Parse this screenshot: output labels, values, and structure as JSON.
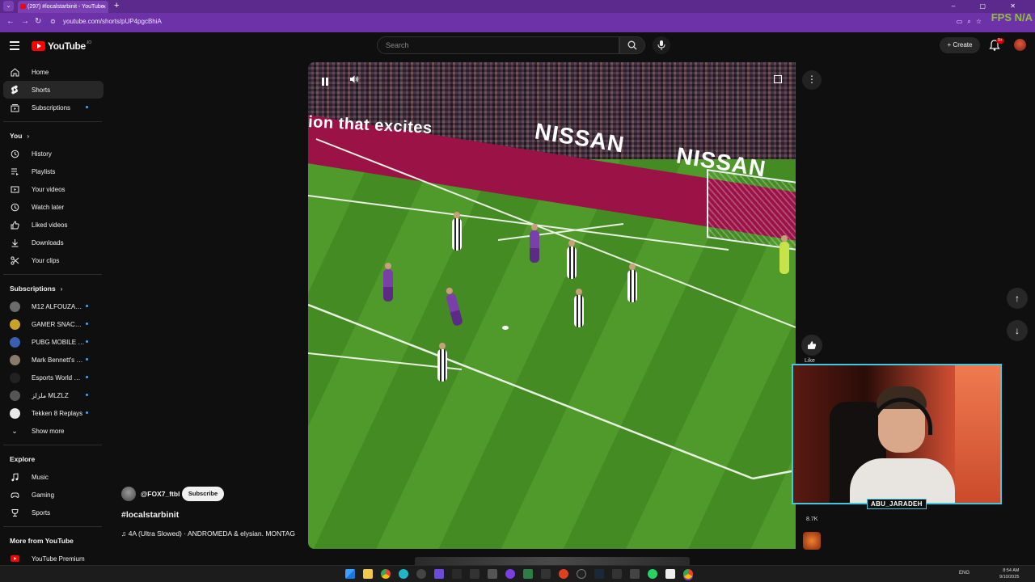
{
  "browser": {
    "tab_title": "(297) #localstarbinit - YouTube",
    "tab_close": "×",
    "new_tab": "+",
    "url": "youtube.com/shorts/pUP4pgcBhiA",
    "window_controls": "– ▢ ✕",
    "overlay": "FPS N/A",
    "colors": {
      "frame": "#5b2a8c",
      "address_bar": "#6d31a8"
    }
  },
  "header": {
    "logo_text": "YouTube",
    "logo_sup": "JO",
    "search_placeholder": "Search",
    "create_label": "Create",
    "notification_count": "9+"
  },
  "sidebar": {
    "main": [
      {
        "label": "Home",
        "icon": "home-icon",
        "active": false
      },
      {
        "label": "Shorts",
        "icon": "shorts-icon",
        "active": true
      },
      {
        "label": "Subscriptions",
        "icon": "subscriptions-icon",
        "active": false
      }
    ],
    "you_heading": "You",
    "you_items": [
      {
        "label": "History",
        "icon": "history-icon"
      },
      {
        "label": "Playlists",
        "icon": "playlists-icon"
      },
      {
        "label": "Your videos",
        "icon": "your-videos-icon"
      },
      {
        "label": "Watch later",
        "icon": "watch-later-icon"
      },
      {
        "label": "Liked videos",
        "icon": "liked-videos-icon"
      },
      {
        "label": "Downloads",
        "icon": "downloads-icon"
      },
      {
        "label": "Your clips",
        "icon": "clips-icon"
      }
    ],
    "subscriptions_heading": "Subscriptions",
    "subscriptions": [
      {
        "label": "M12 ALFOUZAN ...",
        "color": "#6b6b6b"
      },
      {
        "label": "GAMER SNACK | ...",
        "color": "#c9a227"
      },
      {
        "label": "PUBG MOBILE E...",
        "color": "#3a5fb0"
      },
      {
        "label": "Mark Bennett's C...",
        "color": "#8a7a6a"
      },
      {
        "label": "Esports World Cup",
        "color": "#222222"
      },
      {
        "label": "ملزلز MLZLZ",
        "color": "#555555"
      },
      {
        "label": "Tekken 8 Replays",
        "color": "#e8e8e8"
      }
    ],
    "show_more": "Show more",
    "explore_heading": "Explore",
    "explore": [
      {
        "label": "Music",
        "icon": "music-icon"
      },
      {
        "label": "Gaming",
        "icon": "gaming-icon"
      },
      {
        "label": "Sports",
        "icon": "sports-icon"
      }
    ],
    "more_heading": "More from YouTube",
    "more": [
      {
        "label": "YouTube Premium",
        "icon": "youtube-premium-icon"
      }
    ]
  },
  "video": {
    "board_text": "ion that excites",
    "sponsor_1": "NISSAN",
    "sponsor_2": "NISSAN",
    "more_glyph": "⋮"
  },
  "short": {
    "channel": "@FOX7_ftbl",
    "subscribe_label": "Subscribe",
    "title": "#localstarbinit",
    "music": "♫ 4A (Ultra Slowed) · ANDROMEDA & elysian.   MONTAG"
  },
  "actions": {
    "up": "↑",
    "down": "↓",
    "like_label": "Like",
    "count_label": "8.7K"
  },
  "webcam": {
    "label": "ABU_JARADEH"
  },
  "taskbar": {
    "tray": "ENG",
    "time": "8:54 AM",
    "date": "9/10/2025"
  }
}
